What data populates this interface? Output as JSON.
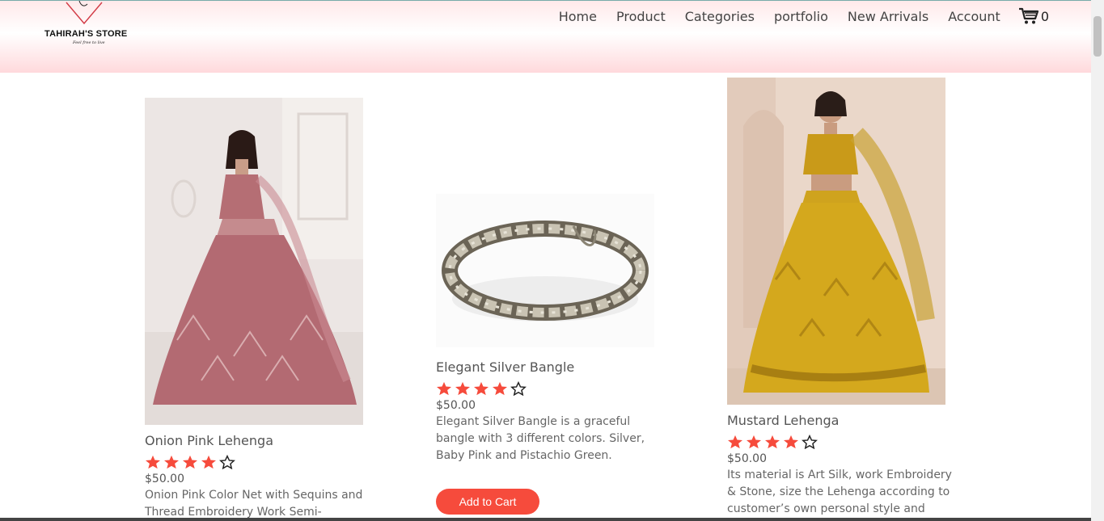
{
  "logo": {
    "name": "TAHIRAH'S STORE",
    "tagline": "Feel free to live"
  },
  "nav": {
    "items": [
      "Home",
      "Product",
      "Categories",
      "portfolio",
      "New Arrivals",
      "Account"
    ],
    "cart_count": "0"
  },
  "colors": {
    "accent": "#f64b3c",
    "header_pink": "#ffd9dc"
  },
  "products": [
    {
      "title": "Onion Pink Lehenga",
      "rating": 4,
      "rating_max": 5,
      "price": "$50.00",
      "description": "Onion Pink Color Net with Sequins and Thread Embroidery Work Semi-"
    },
    {
      "title": "Elegant Silver Bangle",
      "rating": 4,
      "rating_max": 5,
      "price": "$50.00",
      "description": "Elegant Silver Bangle is a graceful bangle with 3 different colors. Silver, Baby Pink and Pistachio Green.",
      "button": "Add to Cart"
    },
    {
      "title": "Mustard Lehenga",
      "rating": 4,
      "rating_max": 5,
      "price": "$50.00",
      "description": "Its material is Art Silk, work Embroidery & Stone, size the Lehenga according to customer’s own personal style and"
    }
  ]
}
